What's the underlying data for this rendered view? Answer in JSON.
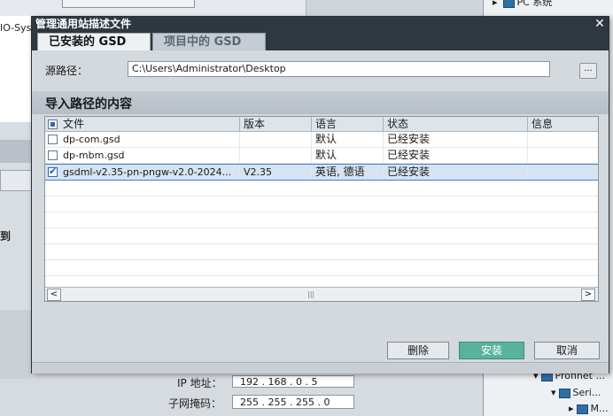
{
  "background": {
    "left_label": "IO-Sys",
    "left_bold": "到",
    "pc_system": "PC 系统",
    "ip_label": "IP 地址：",
    "ip_value": "192 . 168 . 0   . 5",
    "mask_label": "子网掩码：",
    "mask_value": "255 . 255 . 255 . 0",
    "tree_item_1": "Profinet ...",
    "tree_item_2": "Seri...",
    "tree_item_3": "M..."
  },
  "dialog": {
    "title": "管理通用站描述文件",
    "close_icon": "✕",
    "tabs": [
      {
        "label": "已安装的 GSD",
        "active": true
      },
      {
        "label": "项目中的 GSD",
        "active": false
      }
    ],
    "source_path_label": "源路径：",
    "source_path_value": "C:\\Users\\Administrator\\Desktop",
    "browse_label": "...",
    "section_title": "导入路径的内容",
    "columns": [
      "文件",
      "版本",
      "语言",
      "状态",
      "信息"
    ],
    "rows": [
      {
        "file": "dp-com.gsd",
        "version": "",
        "language": "默认",
        "status": "已经安装",
        "info": "",
        "checked": false
      },
      {
        "file": "dp-mbm.gsd",
        "version": "",
        "language": "默认",
        "status": "已经安装",
        "info": "",
        "checked": false
      },
      {
        "file": "gsdml-v2.35-pn-pngw-v2.0-2024...",
        "version": "V2.35",
        "language": "英语, 德语",
        "status": "已经安装",
        "info": "",
        "checked": true
      }
    ],
    "buttons": {
      "delete": "删除",
      "install": "安装",
      "cancel": "取消"
    },
    "accent_color": "#58b39a",
    "selection_color": "#d5e3f2"
  }
}
